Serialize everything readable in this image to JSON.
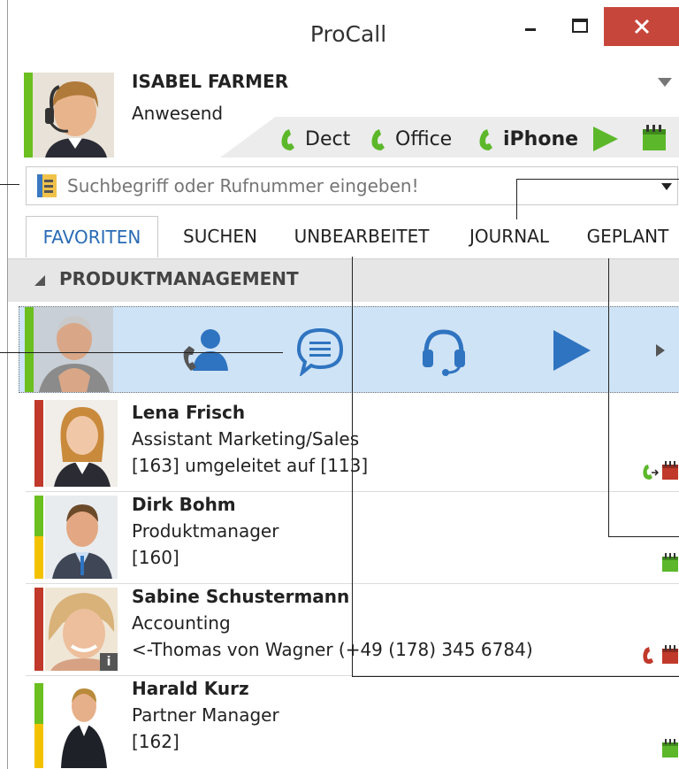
{
  "window": {
    "title": "ProCall",
    "minimize_label": "–",
    "maximize_label": "☐",
    "close_label": "✕"
  },
  "user": {
    "name": "ISABEL FARMER",
    "status": "Anwesend",
    "presence_color": "#6bbf1f"
  },
  "devices": [
    {
      "label": "Dect",
      "bold": false
    },
    {
      "label": "Office",
      "bold": false
    },
    {
      "label": "iPhone",
      "bold": true
    }
  ],
  "search": {
    "placeholder": "Suchbegriff oder Rufnummer eingeben!"
  },
  "tabs": [
    {
      "label": "FAVORITEN",
      "active": true
    },
    {
      "label": "SUCHEN",
      "active": false
    },
    {
      "label": "UNBEARBEITET",
      "active": false
    },
    {
      "label": "JOURNAL",
      "active": false
    },
    {
      "label": "GEPLANT",
      "active": false
    }
  ],
  "group": {
    "label": "PRODUKTMANAGEMENT"
  },
  "contacts": [
    {
      "name": "Lena Frisch",
      "role": "Assistant Marketing/Sales",
      "info": "[163] umgeleitet auf [113]",
      "status": "busy"
    },
    {
      "name": "Dirk Bohm",
      "role": "Produktmanager",
      "info": "[160]",
      "status": "away"
    },
    {
      "name": "Sabine Schustermann",
      "role": "Accounting",
      "info": "<-Thomas von Wagner (+49 (178) 345 6784)",
      "status": "busy"
    },
    {
      "name": "Harald Kurz",
      "role": "Partner Manager",
      "info": "[162]",
      "status": "away"
    }
  ],
  "colors": {
    "accent": "#2a6bb5",
    "green": "#6bbf1f",
    "red": "#c0392b",
    "yellow": "#f2c200",
    "close": "#c7463c",
    "selection": "#cfe3f6"
  }
}
